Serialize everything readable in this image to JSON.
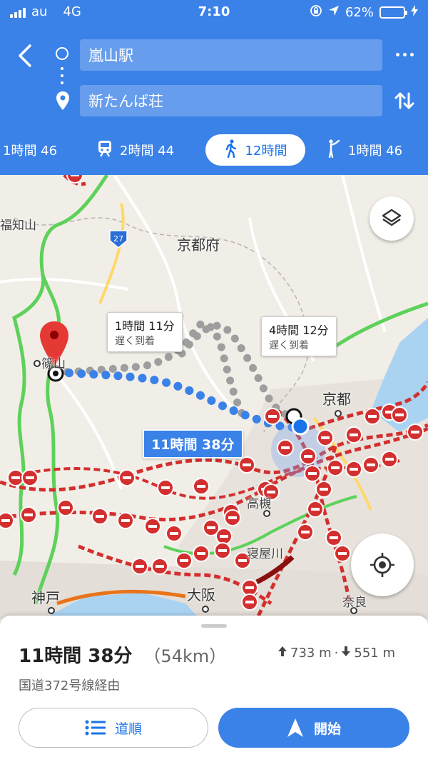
{
  "status_bar": {
    "carrier": "au",
    "network": "4G",
    "time": "7:10",
    "battery_percent": "62%",
    "battery_level": 0.62,
    "battery_color": "#35d74a"
  },
  "header": {
    "origin": "嵐山駅",
    "destination": "新たんば荘",
    "accent_color": "#3b82e8"
  },
  "modes": [
    {
      "icon": "car-icon",
      "label": "1時間 46"
    },
    {
      "icon": "train-icon",
      "label": "2時間 44"
    },
    {
      "icon": "walk-icon",
      "label": "12時間",
      "selected": true
    },
    {
      "icon": "ride-icon",
      "label": "1時間 46"
    }
  ],
  "map": {
    "place_labels": {
      "fukuchiyama": "福知山",
      "kyoto_fu": "京都府",
      "sasayama": "篠山",
      "kyoto": "京都",
      "takatsuki": "高槻",
      "neyagawa": "寝屋川",
      "kobe": "神戸",
      "osaka": "大阪",
      "nara": "奈良"
    },
    "road_shield": "27",
    "alt_route_1": {
      "time": "1時間 11分",
      "note": "遅く到着"
    },
    "alt_route_2": {
      "time": "4時間 12分",
      "note": "遅く到着"
    },
    "main_route": {
      "time": "11時間 38分"
    }
  },
  "sheet": {
    "duration": "11時間 38分",
    "distance": "（54km）",
    "ascent": "733 m",
    "separator": "·",
    "descent": "551 m",
    "via": "国道372号線経由",
    "steps_label": "道順",
    "start_label": "開始"
  }
}
